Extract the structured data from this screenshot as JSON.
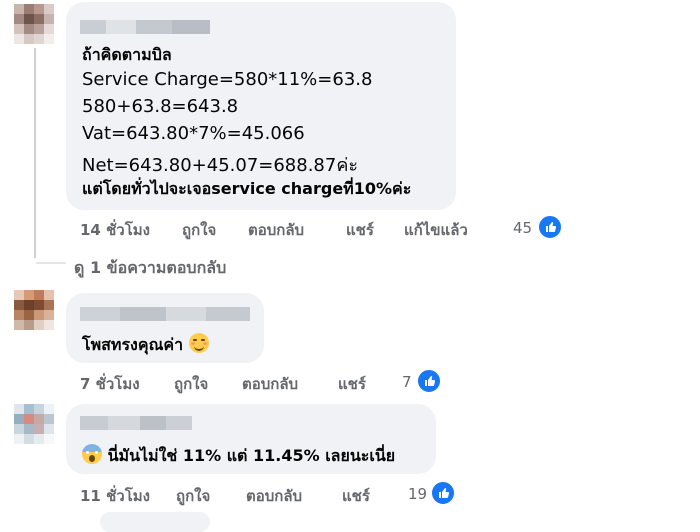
{
  "comments": [
    {
      "lines": [
        "ถ้าคิดตามบิล",
        "Service Charge=580*11%=63.8",
        "580+63.8=643.8",
        "Vat=643.80*7%=45.066",
        "Net=643.80+45.07=688.87ค่ะ",
        "แต่โดยทั่วไปจะเจอservice chargeที่10%ค่ะ"
      ],
      "actions": {
        "time": "14 ชั่วโมง",
        "like": "ถูกใจ",
        "reply": "ตอบกลับ",
        "share": "แชร์",
        "edited": "แก้ไขแล้ว"
      },
      "reaction_count": "45",
      "view_replies": "ดู 1 ข้อความตอบกลับ"
    },
    {
      "text": "โพสทรงคุณค่า",
      "emoji": "smiling-face-icon",
      "actions": {
        "time": "7 ชั่วโมง",
        "like": "ถูกใจ",
        "reply": "ตอบกลับ",
        "share": "แชร์"
      },
      "reaction_count": "7"
    },
    {
      "text": "นี่มันไม่ใช่ 11% แต่ 11.45% เลยนะเนี่ย",
      "emoji": "screaming-face-icon",
      "actions": {
        "time": "11 ชั่วโมง",
        "like": "ถูกใจ",
        "reply": "ตอบกลับ",
        "share": "แชร์"
      },
      "reaction_count": "19"
    }
  ],
  "colors": {
    "bubble": "#f0f2f5",
    "meta": "#65676b",
    "like_blue": "#1877f2"
  }
}
